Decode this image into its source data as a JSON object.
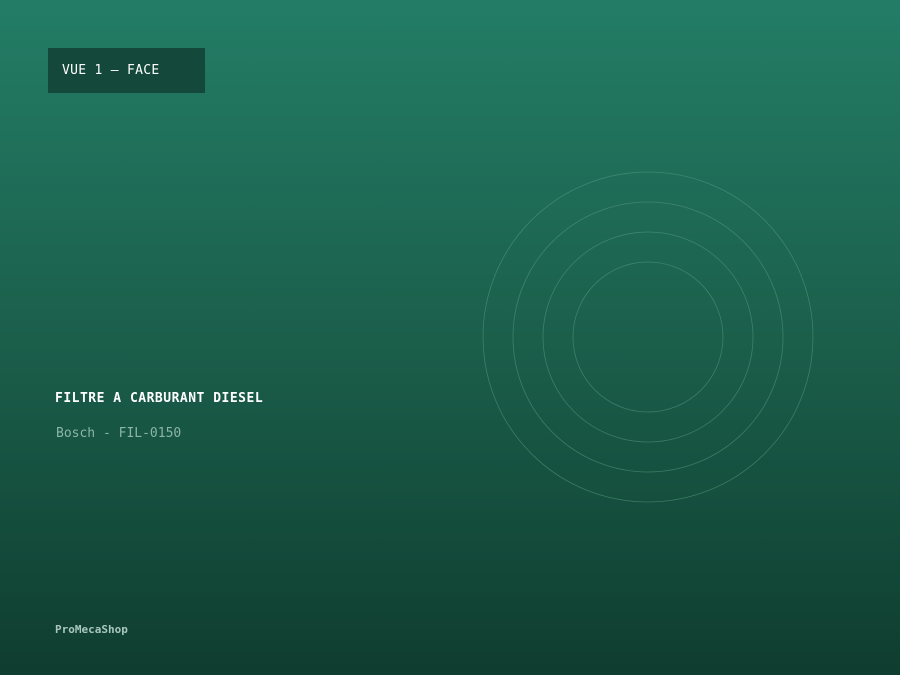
{
  "view": {
    "label": "VUE 1 — FACE"
  },
  "product": {
    "title": "FILTRE A CARBURANT DIESEL",
    "subtitle": "Bosch - FIL-0150"
  },
  "brand": {
    "name": "ProMecaShop"
  },
  "colors": {
    "background_top": "#237d66",
    "background_bottom": "#0f3d30",
    "badge": "#13483b",
    "ring_stroke": "#5a9c86"
  },
  "graphic": {
    "icon": "concentric-rings-icon",
    "ring_count": 4
  }
}
